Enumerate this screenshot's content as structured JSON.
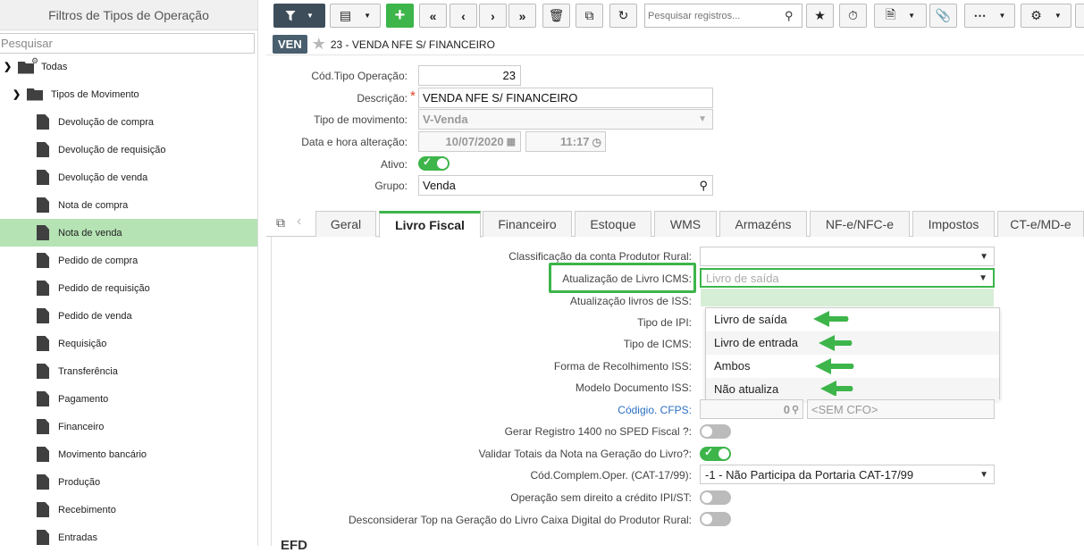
{
  "sidebar": {
    "title": "Filtros de Tipos de Operação",
    "search_placeholder": "Pesquisar",
    "root": "Todas",
    "group": "Tipos de Movimento",
    "items": [
      {
        "label": "Devolução de compra"
      },
      {
        "label": "Devolução de requisição"
      },
      {
        "label": "Devolução de venda"
      },
      {
        "label": "Nota de compra"
      },
      {
        "label": "Nota de venda",
        "selected": true
      },
      {
        "label": "Pedido de compra"
      },
      {
        "label": "Pedido de requisição"
      },
      {
        "label": "Pedido de venda"
      },
      {
        "label": "Requisição"
      },
      {
        "label": "Transferência"
      },
      {
        "label": "Pagamento"
      },
      {
        "label": "Financeiro"
      },
      {
        "label": "Movimento bancário"
      },
      {
        "label": "Produção"
      },
      {
        "label": "Recebimento"
      },
      {
        "label": "Entradas"
      }
    ]
  },
  "toolbar": {
    "search_placeholder": "Pesquisar registros..."
  },
  "record": {
    "badge": "VEN",
    "title": "23 - VENDA NFE S/ FINANCEIRO"
  },
  "form": {
    "cod_label": "Cód.Tipo Operação:",
    "cod_value": "23",
    "desc_label": "Descrição:",
    "desc_value": "VENDA NFE S/ FINANCEIRO",
    "tipo_label": "Tipo de movimento:",
    "tipo_value": "V-Venda",
    "data_label": "Data e hora alteração:",
    "date_value": "10/07/2020",
    "time_value": "11:17",
    "ativo_label": "Ativo:",
    "grupo_label": "Grupo:",
    "grupo_value": "Venda"
  },
  "tabs": [
    "Geral",
    "Livro Fiscal",
    "Financeiro",
    "Estoque",
    "WMS",
    "Armazéns",
    "NF-e/NFC-e",
    "Impostos",
    "CT-e/MD-e"
  ],
  "active_tab": "Livro Fiscal",
  "fiscal": {
    "class_label": "Classificação da conta Produtor Rural:",
    "icms_label": "Atualização de Livro ICMS:",
    "icms_placeholder": "Livro de saída",
    "iss_label": "Atualização livros de ISS:",
    "ipi_label": "Tipo de IPI:",
    "tipo_icms_label": "Tipo de ICMS:",
    "forma_iss_label": "Forma de Recolhimento ISS:",
    "modelo_iss_label": "Modelo Documento ISS:",
    "cfps_label": "Códigio. CFPS:",
    "cfps_value": "0",
    "cfps_desc": "<SEM CFO>",
    "reg1400_label": "Gerar Registro 1400 no SPED Fiscal ?:",
    "validar_label": "Validar Totais da Nota na Geração do Livro?:",
    "cat_label": "Cód.Complem.Oper. (CAT-17/99):",
    "cat_value": "-1 - Não Participa da Portaria CAT-17/99",
    "credito_label": "Operação sem direito a crédito IPI/ST:",
    "desconsiderar_label": "Desconsiderar Top na Geração do Livro Caixa Digital do Produtor Rural:",
    "section_next": "EFD"
  },
  "dropdown_options": [
    "Livro de saída",
    "Livro de entrada",
    "Ambos",
    "Não atualiza"
  ],
  "colors": {
    "accent_green": "#3db54a",
    "highlight": "#b5e3b4",
    "badge": "#4a5f6e",
    "link_blue": "#2a6fc4",
    "toolbar_dark": "#3d4d5a"
  }
}
